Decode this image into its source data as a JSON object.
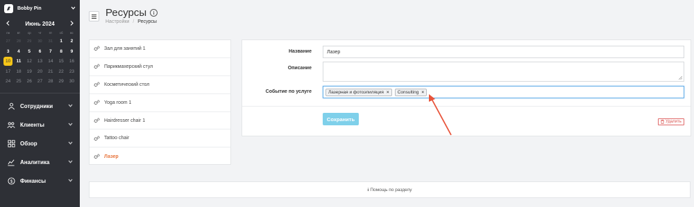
{
  "sidebar": {
    "brand_name": "Bobby Pin",
    "calendar": {
      "title": "Июнь 2024",
      "weekdays": [
        "пн",
        "вт",
        "ср",
        "чт",
        "пт",
        "сб",
        "вс"
      ],
      "days": [
        {
          "label": "27",
          "state": "dim"
        },
        {
          "label": "28",
          "state": "dim"
        },
        {
          "label": "29",
          "state": "dim"
        },
        {
          "label": "30",
          "state": "dim"
        },
        {
          "label": "31",
          "state": "dim"
        },
        {
          "label": "1",
          "state": "cur"
        },
        {
          "label": "2",
          "state": "cur"
        },
        {
          "label": "3",
          "state": "cur"
        },
        {
          "label": "4",
          "state": "cur"
        },
        {
          "label": "5",
          "state": "cur"
        },
        {
          "label": "6",
          "state": "cur"
        },
        {
          "label": "7",
          "state": "cur"
        },
        {
          "label": "8",
          "state": "cur"
        },
        {
          "label": "9",
          "state": "cur"
        },
        {
          "label": "10",
          "state": "today"
        },
        {
          "label": "11",
          "state": "cur"
        },
        {
          "label": "12",
          "state": "normal"
        },
        {
          "label": "13",
          "state": "normal"
        },
        {
          "label": "14",
          "state": "normal"
        },
        {
          "label": "15",
          "state": "normal"
        },
        {
          "label": "16",
          "state": "normal"
        },
        {
          "label": "17",
          "state": "normal"
        },
        {
          "label": "18",
          "state": "normal"
        },
        {
          "label": "19",
          "state": "normal"
        },
        {
          "label": "20",
          "state": "normal"
        },
        {
          "label": "21",
          "state": "normal"
        },
        {
          "label": "22",
          "state": "normal"
        },
        {
          "label": "23",
          "state": "normal"
        },
        {
          "label": "24",
          "state": "normal"
        },
        {
          "label": "25",
          "state": "normal"
        },
        {
          "label": "26",
          "state": "normal"
        },
        {
          "label": "27",
          "state": "normal"
        },
        {
          "label": "28",
          "state": "normal"
        },
        {
          "label": "29",
          "state": "normal"
        },
        {
          "label": "30",
          "state": "normal"
        }
      ]
    },
    "nav": [
      {
        "label": "Сотрудники",
        "icon": "staff-icon"
      },
      {
        "label": "Клиенты",
        "icon": "clients-icon"
      },
      {
        "label": "Обзор",
        "icon": "overview-icon"
      },
      {
        "label": "Аналитика",
        "icon": "analytics-icon"
      },
      {
        "label": "Финансы",
        "icon": "finance-icon"
      }
    ]
  },
  "header": {
    "title": "Ресурсы",
    "breadcrumb": [
      "Настройки",
      "Ресурсы"
    ]
  },
  "resources": [
    {
      "label": "Зал для занятий 1"
    },
    {
      "label": "Парикмахерский стул"
    },
    {
      "label": "Косметический стол"
    },
    {
      "label": "Yoga room 1"
    },
    {
      "label": "Hairdresser chair 1"
    },
    {
      "label": "Tattoo chair"
    },
    {
      "label": "Лазер",
      "active": true
    }
  ],
  "form": {
    "name_label": "Название",
    "name_value": "Лазер",
    "description_label": "Описание",
    "description_value": "",
    "service_event_label": "Событие по услуге",
    "tags": [
      "Лазерная и фотоэпиляция",
      "Consulting"
    ],
    "save_label": "Сохранить",
    "delete_label": "Удалить"
  },
  "help": {
    "label": "Помощь по разделу"
  },
  "colors": {
    "sidebar_bg": "#2e3036",
    "today_highlight": "#f5c518",
    "active_resource": "#e8743b",
    "save_button": "#7fd0ea",
    "delete": "#d9534f",
    "annotation_arrow": "#e8543b"
  }
}
